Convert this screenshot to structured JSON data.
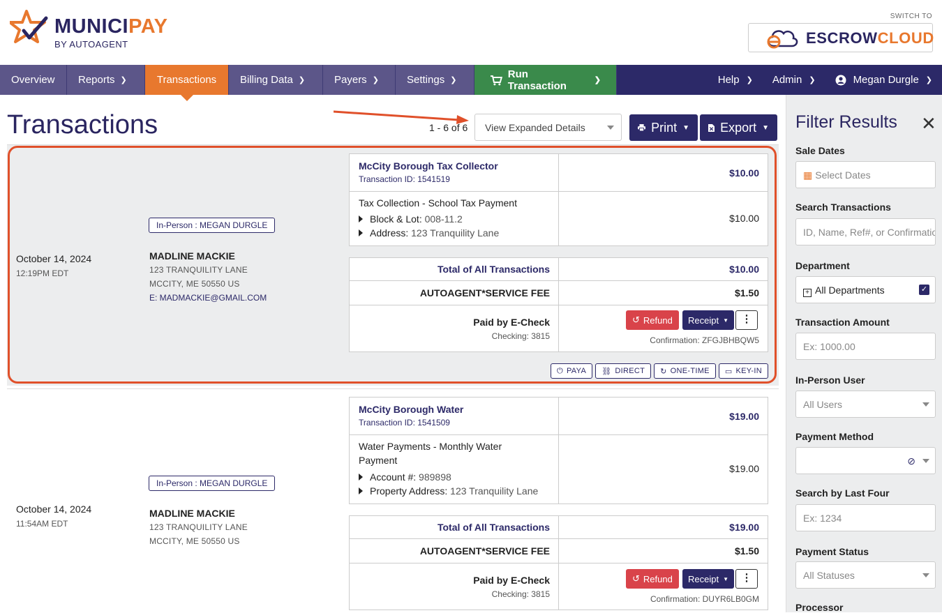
{
  "header": {
    "brand_main": "MUNICI",
    "brand_accent": "PAY",
    "brand_sub": "BY AUTOAGENT",
    "switch_label": "SWITCH TO",
    "escrow_main": "ESCROW",
    "escrow_accent": "CLOUD"
  },
  "nav": {
    "items": [
      {
        "label": "Overview"
      },
      {
        "label": "Reports"
      },
      {
        "label": "Transactions"
      },
      {
        "label": "Billing Data"
      },
      {
        "label": "Payers"
      },
      {
        "label": "Settings"
      },
      {
        "label": "Run Transaction"
      }
    ],
    "help": "Help",
    "admin": "Admin",
    "user": "Megan Durgle"
  },
  "page": {
    "title": "Transactions",
    "count": "1 - 6 of 6",
    "view_select": "View Expanded Details",
    "print_label": "Print",
    "export_label": "Export"
  },
  "transactions": [
    {
      "date": "October 14, 2024",
      "time": "12:19PM EDT",
      "badge": "In-Person : MEGAN DURGLE",
      "payer_name": "MADLINE MACKIE",
      "addr1": "123 TRANQUILITY LANE",
      "addr2": "MCCITY, ME 50550 US",
      "email": "E: MADMACKIE@GMAIL.COM",
      "dept": "McCity Borough Tax Collector",
      "txn_id": "Transaction ID: 1541519",
      "dept_amount": "$10.00",
      "service": "Tax Collection - School Tax Payment",
      "detail1_label": "Block & Lot:",
      "detail1_value": "008-11.2",
      "detail2_label": "Address:",
      "detail2_value": "123 Tranquility Lane",
      "service_amount": "$10.00",
      "total_label": "Total of All Transactions",
      "total_amount": "$10.00",
      "fee_label": "AUTOAGENT*SERVICE FEE",
      "fee_amount": "$1.50",
      "paid_by": "Paid by E-Check",
      "account": "Checking: 3815",
      "refund_label": "Refund",
      "receipt_label": "Receipt",
      "confirmation": "Confirmation: ZFGJBHBQW5",
      "tags": [
        "PAYA",
        "DIRECT",
        "ONE-TIME",
        "KEY-IN"
      ]
    },
    {
      "date": "October 14, 2024",
      "time": "11:54AM EDT",
      "badge": "In-Person : MEGAN DURGLE",
      "payer_name": "MADLINE MACKIE",
      "addr1": "123 TRANQUILITY LANE",
      "addr2": "MCCITY, ME 50550 US",
      "dept": "McCity Borough Water",
      "txn_id": "Transaction ID: 1541509",
      "dept_amount": "$19.00",
      "service_line1": "Water Payments - Monthly Water",
      "service_line2": "Payment",
      "detail1_label": "Account #:",
      "detail1_value": "989898",
      "detail2_label": "Property Address:",
      "detail2_value": "123 Tranquility Lane",
      "service_amount": "$19.00",
      "total_label": "Total of All Transactions",
      "total_amount": "$19.00",
      "fee_label": "AUTOAGENT*SERVICE FEE",
      "fee_amount": "$1.50",
      "paid_by": "Paid by E-Check",
      "account": "Checking: 3815",
      "refund_label": "Refund",
      "receipt_label": "Receipt",
      "confirmation": "Confirmation: DUYR6LB0GM"
    }
  ],
  "filter": {
    "title": "Filter Results",
    "sale_dates_label": "Sale Dates",
    "sale_dates_placeholder": "Select Dates",
    "search_label": "Search Transactions",
    "search_placeholder": "ID, Name, Ref#, or Confirmation",
    "department_label": "Department",
    "department_value": "All Departments",
    "amount_label": "Transaction Amount",
    "amount_placeholder": "Ex: 1000.00",
    "inperson_label": "In-Person User",
    "inperson_value": "All Users",
    "method_label": "Payment Method",
    "lastfour_label": "Search by Last Four",
    "lastfour_placeholder": "Ex: 1234",
    "status_label": "Payment Status",
    "status_value": "All Statuses",
    "processor_label": "Processor"
  },
  "colors": {
    "navy": "#2c2968",
    "orange": "#e8782e",
    "green": "#3a8a4b",
    "red": "#d9434a",
    "highlight": "#e0502a"
  }
}
